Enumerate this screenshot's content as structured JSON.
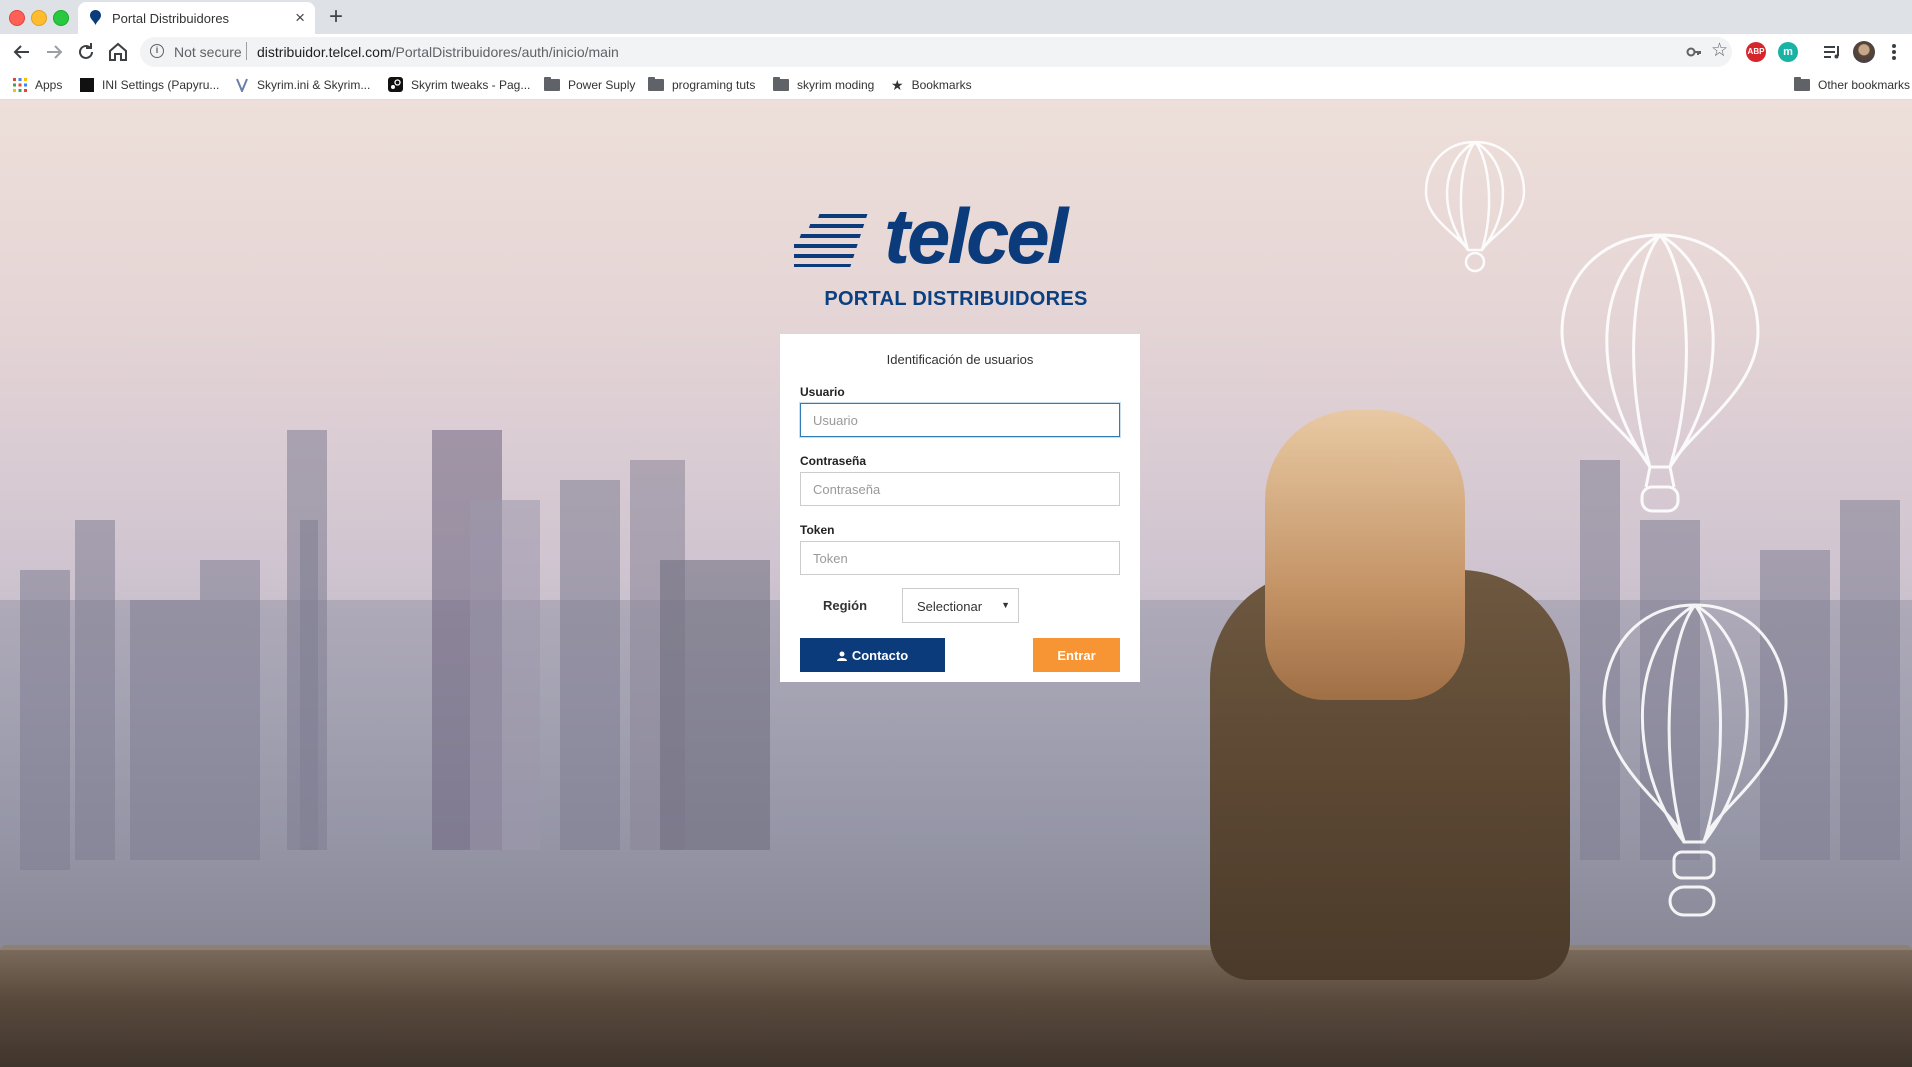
{
  "browser": {
    "tab": {
      "title": "Portal Distribuidores",
      "close": "×"
    },
    "new_tab": "+",
    "address": {
      "security": "Not secure",
      "url_host": "distribuidor.telcel.com",
      "url_path": "/PortalDistribuidores/auth/inicio/main"
    },
    "extensions": {
      "abp": "ABP",
      "m": "m"
    },
    "bookmarks": [
      {
        "label": "Apps",
        "icon": "apps-grid-icon"
      },
      {
        "label": "INI Settings (Papyru...",
        "icon": "site-icon"
      },
      {
        "label": "Skyrim.ini & Skyrim...",
        "icon": "site-icon"
      },
      {
        "label": "Skyrim tweaks - Pag...",
        "icon": "steam-icon"
      },
      {
        "label": "Power Suply",
        "icon": "folder-icon"
      },
      {
        "label": "programing tuts",
        "icon": "folder-icon"
      },
      {
        "label": "skyrim moding",
        "icon": "folder-icon"
      },
      {
        "label": "Bookmarks",
        "icon": "star-icon"
      }
    ],
    "other_bookmarks": "Other bookmarks"
  },
  "page": {
    "brand": "telcel",
    "title": "PORTAL DISTRIBUIDORES",
    "login": {
      "heading": "Identificación de usuarios",
      "usuario_label": "Usuario",
      "usuario_placeholder": "Usuario",
      "password_label": "Contraseña",
      "password_placeholder": "Contraseña",
      "token_label": "Token",
      "token_placeholder": "Token",
      "region_label": "Región",
      "region_value": "Selectionar",
      "contacto_button": "Contacto",
      "entrar_button": "Entrar"
    }
  },
  "colors": {
    "brand_blue": "#0b3b7a",
    "accent_orange": "#f79433"
  }
}
